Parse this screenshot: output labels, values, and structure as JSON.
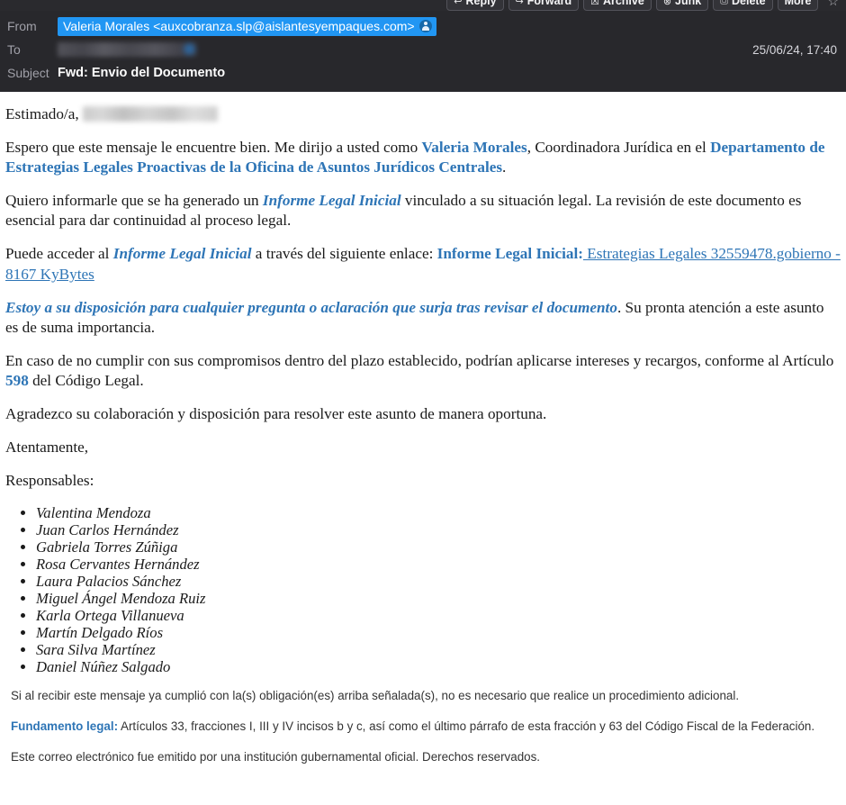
{
  "toolbar": {
    "buttons": [
      {
        "icon": "reply-icon",
        "glyph": "↩",
        "label": "Reply"
      },
      {
        "icon": "forward-icon",
        "glyph": "↪",
        "label": "Forward"
      },
      {
        "icon": "archive-icon",
        "glyph": "☒",
        "label": "Archive"
      },
      {
        "icon": "junk-icon",
        "glyph": "⊗",
        "label": "Junk"
      },
      {
        "icon": "delete-icon",
        "glyph": "Ὕ1",
        "label": "Delete"
      },
      {
        "icon": "more-icon",
        "glyph": "",
        "label": "More"
      }
    ],
    "star_glyph": "☆",
    "star_icon": "star-icon"
  },
  "header": {
    "from_label": "From",
    "from_value": "Valeria Morales <auxcobranza.slp@aislantesyempaques.com>",
    "from_badge_icon": "contact-avatar-icon",
    "to_label": "To",
    "to_value_redacted": true,
    "date": "25/06/24, 17:40",
    "subject_label": "Subject",
    "subject_value": "Fwd: Envio del Documento"
  },
  "body": {
    "greeting_prefix": "Estimado/a,",
    "greeting_redacted": true,
    "p1": {
      "t1": "Espero que este mensaje le encuentre bien. Me dirijo a usted como ",
      "name": "Valeria Morales",
      "t2": ", Coordinadora Jurídica en el ",
      "dept": "Departamento de Estrategias Legales Proactivas de la Oficina de Asuntos Jurídicos Centrales",
      "t3": "."
    },
    "p2": {
      "t1": "Quiero informarle que se ha generado un ",
      "doc": "Informe Legal Inicial",
      "t2": " vinculado a su situación legal. La revisión de este documento es esencial para dar continuidad al proceso legal."
    },
    "p3": {
      "t1": "Puede acceder al ",
      "doc": "Informe Legal Inicial",
      "t2": " a través del siguiente enlace: ",
      "link_label": "Informe Legal Inicial:",
      "link_text": " Estrategias Legales 32559478.gobierno - 8167 KyBytes"
    },
    "p4": {
      "em": "Estoy a su disposición para cualquier pregunta o aclaración que surja tras revisar el documento",
      "t1": ". Su pronta atención a este asunto es de suma importancia."
    },
    "p5": {
      "t1": "En caso de no cumplir con sus compromisos dentro del plazo establecido, podrían aplicarse intereses y recargos, conforme al Artículo ",
      "article": "598",
      "t2": " del Código Legal."
    },
    "p6": "Agradezco su colaboración y disposición para resolver este asunto de manera oportuna.",
    "p7": "Atentamente,",
    "p8": "Responsables:",
    "responsables": [
      "Valentina Mendoza",
      "Juan Carlos Hernández",
      "Gabriela Torres Zúñiga",
      "Rosa Cervantes Hernández",
      "Laura Palacios Sánchez",
      "Miguel Ángel Mendoza Ruiz",
      "Karla Ortega Villanueva",
      "Martín Delgado Ríos",
      "Sara Silva Martínez",
      "Daniel Núñez Salgado"
    ]
  },
  "footer": {
    "f1": "Si al recibir este mensaje ya cumplió con la(s) obligación(es) arriba señalada(s), no es necesario que realice un procedimiento adicional.",
    "f2_label": "Fundamento legal:",
    "f2_text": " Artículos 33, fracciones I, III y IV incisos b y c, así como el último párrafo de esta fracción y 63 del Código Fiscal de la Federación.",
    "f3": "Este correo electrónico fue emitido por una institución gubernamental oficial. Derechos reservados."
  },
  "colors": {
    "accent_blue": "#2e75b6",
    "pill_blue": "#2196f3",
    "header_bg": "#28282c",
    "toolbar_bg": "#2a2a2e"
  }
}
